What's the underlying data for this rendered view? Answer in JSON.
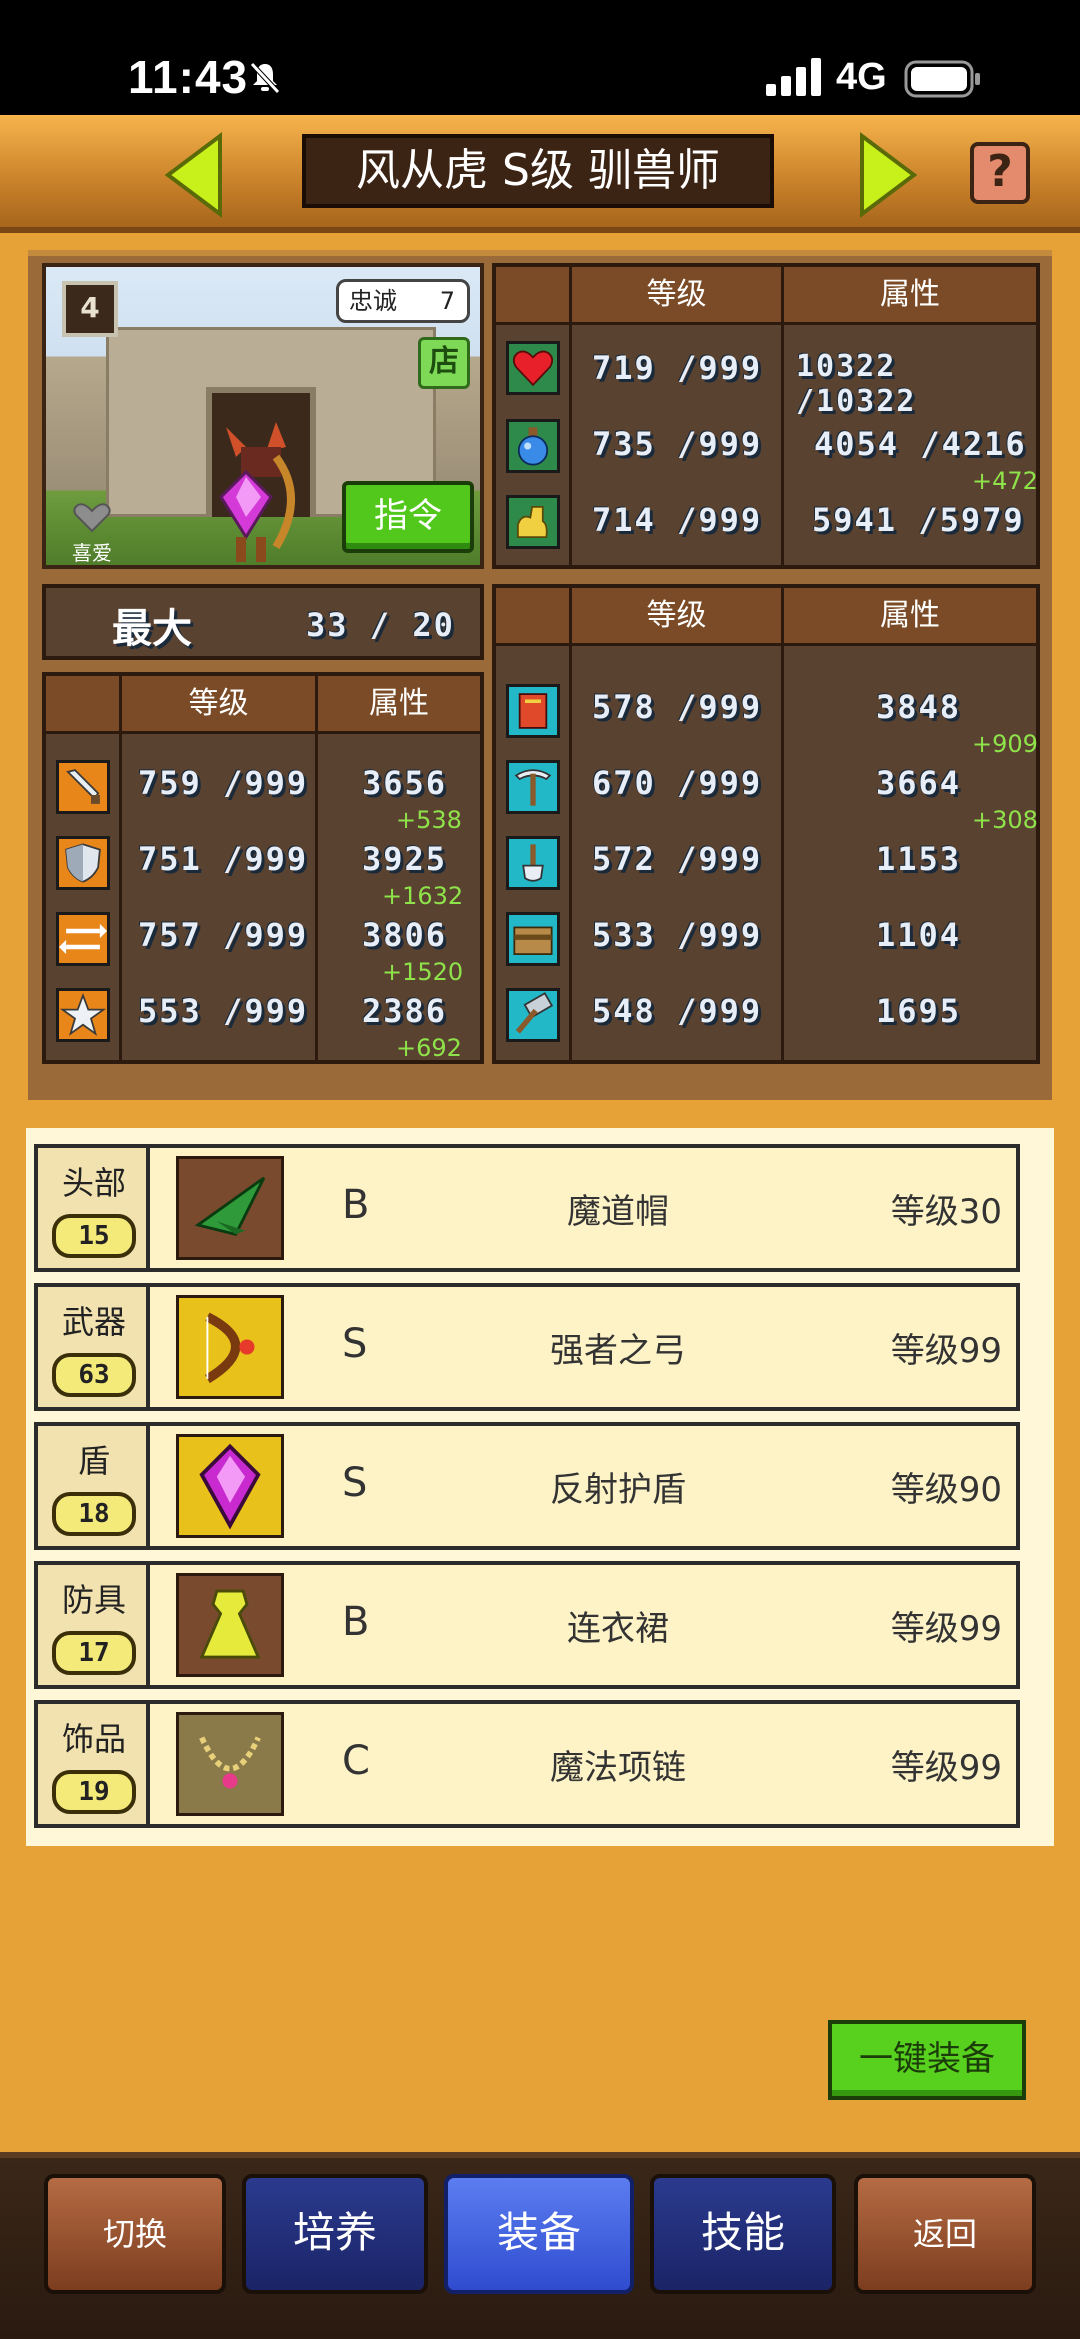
{
  "status_bar": {
    "time": "11:43",
    "network": "4G"
  },
  "header": {
    "title": "风从虎 S级 驯兽师"
  },
  "character": {
    "level_badge": "4",
    "loyalty_label": "忠诚",
    "loyalty_value": "7",
    "shop_label": "店",
    "command_label": "指令",
    "favorite_label": "喜爱"
  },
  "top_stats": {
    "header_level": "等级",
    "header_attr": "属性",
    "rows": [
      {
        "icon": "heart-icon",
        "level": "719 /999",
        "attr": "10322 /10322",
        "bonus": ""
      },
      {
        "icon": "potion-icon",
        "level": "735 /999",
        "attr": "4054 /4216",
        "bonus": "+472"
      },
      {
        "icon": "muscle-icon",
        "level": "714 /999",
        "attr": "5941 /5979",
        "bonus": ""
      }
    ]
  },
  "max_row": {
    "label": "最大",
    "value": "33 /  20"
  },
  "left_stats": {
    "header_level": "等级",
    "header_attr": "属性",
    "rows": [
      {
        "icon": "sword-icon",
        "level": "759 /999",
        "attr": "3656",
        "bonus": "+538"
      },
      {
        "icon": "shield-icon",
        "level": "751 /999",
        "attr": "3925",
        "bonus": "+1632"
      },
      {
        "icon": "arrows-icon",
        "level": "757 /999",
        "attr": "3806",
        "bonus": "+1520"
      },
      {
        "icon": "star-icon",
        "level": "553 /999",
        "attr": "2386",
        "bonus": "+692"
      }
    ]
  },
  "right_stats": {
    "header_level": "等级",
    "header_attr": "属性",
    "rows": [
      {
        "icon": "book-icon",
        "level": "578 /999",
        "attr": "3848",
        "bonus": "+909"
      },
      {
        "icon": "pickaxe-icon",
        "level": "670 /999",
        "attr": "3664",
        "bonus": "+308"
      },
      {
        "icon": "shovel-icon",
        "level": "572 /999",
        "attr": "1153",
        "bonus": ""
      },
      {
        "icon": "chest-icon",
        "level": "533 /999",
        "attr": "1104",
        "bonus": ""
      },
      {
        "icon": "hammer-icon",
        "level": "548 /999",
        "attr": "1695",
        "bonus": ""
      }
    ]
  },
  "equipment": [
    {
      "slot": "头部",
      "slot_level": "15",
      "grade": "B",
      "name": "魔道帽",
      "level": "等级30",
      "icon": "witch-hat-icon"
    },
    {
      "slot": "武器",
      "slot_level": "63",
      "grade": "S",
      "name": "强者之弓",
      "level": "等级99",
      "icon": "bow-icon"
    },
    {
      "slot": "盾",
      "slot_level": "18",
      "grade": "S",
      "name": "反射护盾",
      "level": "等级90",
      "icon": "gem-shield-icon"
    },
    {
      "slot": "防具",
      "slot_level": "17",
      "grade": "B",
      "name": "连衣裙",
      "level": "等级99",
      "icon": "dress-icon"
    },
    {
      "slot": "饰品",
      "slot_level": "19",
      "grade": "C",
      "name": "魔法项链",
      "level": "等级99",
      "icon": "necklace-icon"
    }
  ],
  "one_key_equip": "一键装备",
  "bottom_nav": [
    "切换",
    "培养",
    "装备",
    "技能",
    "返回"
  ],
  "colors": {
    "bonus_green": "#8fe34a",
    "active_tab": "#3f5ee0",
    "bg_orange": "#e6a236"
  }
}
